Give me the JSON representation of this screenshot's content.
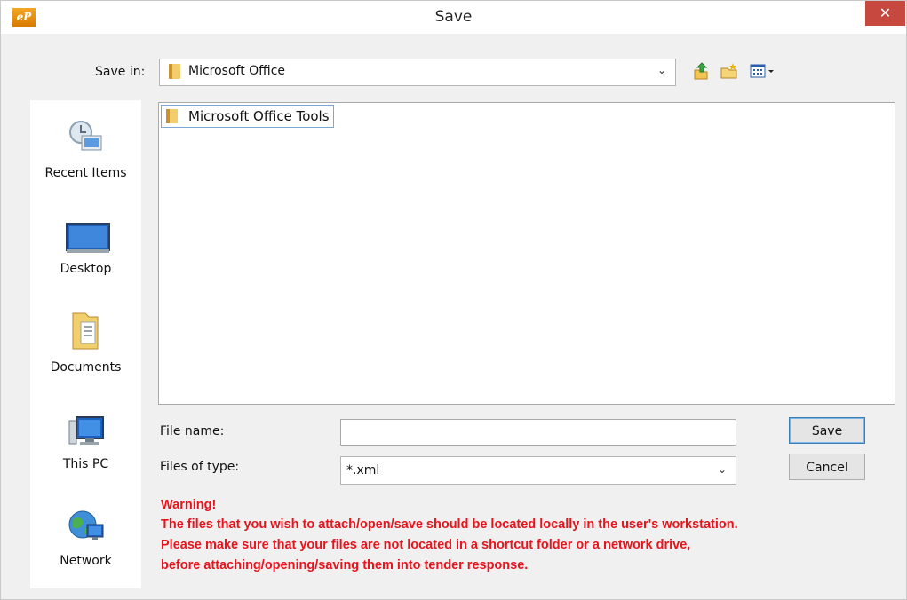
{
  "window": {
    "app_logo": "eP",
    "title": "Save",
    "close_glyph": "✕"
  },
  "toolbar": {
    "save_in_label": "Save in:",
    "save_in_value": "Microsoft Office",
    "dropdown_glyph": "⌄",
    "icons": [
      "up-folder-icon",
      "new-folder-icon",
      "view-menu-icon"
    ]
  },
  "places": [
    {
      "label": "Recent Items",
      "icon": "recent-items-icon"
    },
    {
      "label": "Desktop",
      "icon": "desktop-icon"
    },
    {
      "label": "Documents",
      "icon": "documents-icon"
    },
    {
      "label": "This PC",
      "icon": "this-pc-icon"
    },
    {
      "label": "Network",
      "icon": "network-icon"
    }
  ],
  "files": [
    {
      "name": "Microsoft Office Tools",
      "type": "folder"
    }
  ],
  "form": {
    "file_name_label": "File name:",
    "file_name_value": "",
    "files_of_type_label": "Files of type:",
    "files_of_type_value": "*.xml"
  },
  "buttons": {
    "save": "Save",
    "cancel": "Cancel"
  },
  "warning": {
    "title": "Warning!",
    "line1": "The files that you wish to attach/open/save should be located locally in the user's workstation.",
    "line2": "Please make sure that your files are not located in a shortcut folder or a network drive,",
    "line3": "before attaching/opening/saving them into tender response.",
    "color": "#e8131b"
  }
}
